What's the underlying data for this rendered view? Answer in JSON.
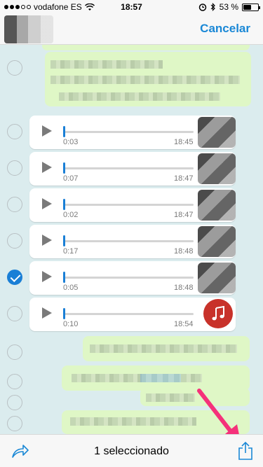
{
  "status_bar": {
    "carrier": "vodafone ES",
    "time": "18:57",
    "battery": "53 %",
    "battery_level": 0.53,
    "icons": [
      "signal-dots-icon",
      "wifi-icon",
      "alarm-icon",
      "bluetooth-icon",
      "battery-icon"
    ]
  },
  "header": {
    "cancel_label": "Cancelar"
  },
  "voice_messages": [
    {
      "duration": "0:03",
      "time": "18:45",
      "selected": false
    },
    {
      "duration": "0:07",
      "time": "18:47",
      "selected": false
    },
    {
      "duration": "0:02",
      "time": "18:47",
      "selected": false
    },
    {
      "duration": "0:17",
      "time": "18:48",
      "selected": false
    },
    {
      "duration": "0:05",
      "time": "18:48",
      "selected": true
    },
    {
      "duration": "0:10",
      "time": "18:54",
      "selected": false
    }
  ],
  "toolbar": {
    "selected_label": "1 seleccionado",
    "forward_icon": "forward-icon",
    "share_icon": "share-icon"
  },
  "colors": {
    "accent": "#1a88d6",
    "chat_bg": "#dbecee",
    "outgoing_bubble": "#dff7c6",
    "arrow": "#f5317a"
  }
}
